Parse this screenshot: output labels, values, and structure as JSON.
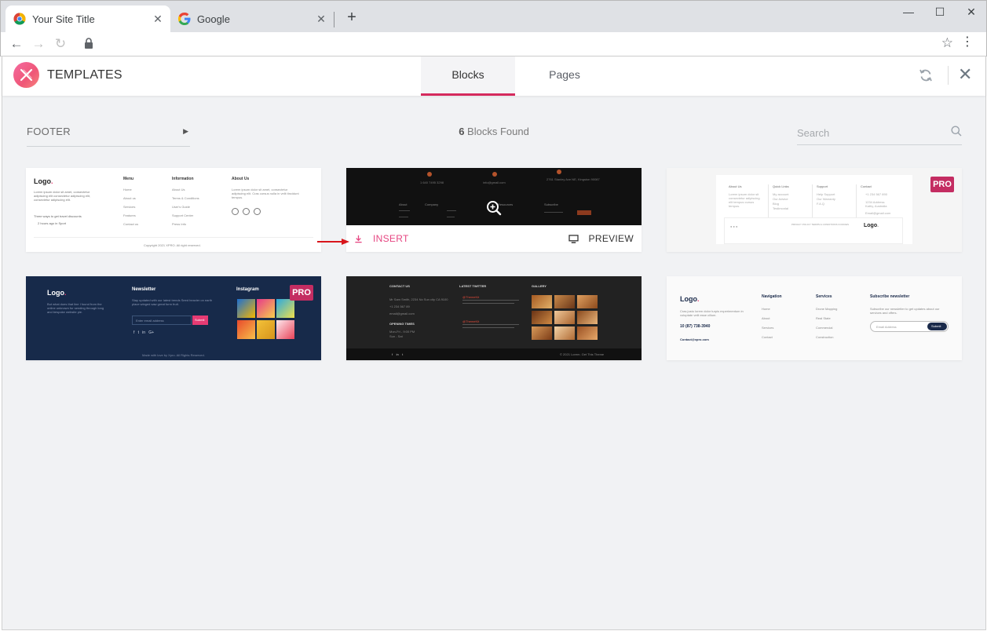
{
  "browser": {
    "tabs": [
      {
        "title": "Your Site Title",
        "active": true,
        "favicon": "chrome-icon"
      },
      {
        "title": "Google",
        "active": false,
        "favicon": "google-icon"
      }
    ],
    "close_glyph": "✕",
    "new_tab_glyph": "+",
    "window_controls": {
      "minimize": "—",
      "maximize": "☐",
      "close": "✕"
    },
    "nav": {
      "back": "←",
      "forward": "→",
      "reload": "↻"
    }
  },
  "app": {
    "title": "TEMPLATES",
    "tabs": [
      {
        "label": "Blocks",
        "active": true
      },
      {
        "label": "Pages",
        "active": false
      }
    ],
    "accent_color": "#d52a5d",
    "close_glyph": "✕"
  },
  "toolbar": {
    "filter_label": "FOOTER",
    "found_count": "6",
    "found_suffix": "Blocks Found",
    "search_placeholder": "Search"
  },
  "cards": {
    "c1": {
      "logo": "Logo",
      "desc": [
        "Lorem ipsum dolor sit amet, consectetur",
        "adipiscing elit consectetur adipiscing elit,",
        "consectetur adipiscing elit."
      ],
      "travel": "Three ways to get travel discounts",
      "hours": "2 hours ago in Sport",
      "menu_title": "Menu",
      "menu": [
        "Home",
        "About us",
        "Services",
        "Features",
        "Contact us"
      ],
      "info_title": "Information",
      "info": [
        "About Us",
        "Terms & Conditions",
        "User's Guide",
        "Support Center",
        "Press Info"
      ],
      "about_title": "About Us",
      "about": [
        "Lorem ipsum dolor sit amet, consectetur",
        "adipiscing elit. Cras cursus nulla in velit tincidunt",
        "tempus."
      ],
      "social": [
        "f",
        "t",
        "G+"
      ],
      "copyright": "Copyright 2021 XPRO. All right reserved."
    },
    "c2": {
      "contacts": [
        "1 640 7495 3298",
        "info@gmail.com",
        "2761 Stanley Ave NE, Kingston 90087"
      ],
      "cols": [
        "About",
        "Company",
        "Resources",
        "Subscribe"
      ],
      "insert_label": "INSERT",
      "preview_label": "PREVIEW"
    },
    "c3": {
      "pro": "PRO",
      "cols": [
        "About Us",
        "Quick Links",
        "Support",
        "Contact"
      ],
      "col_items": [
        [
          "Lorem ipsum dolor sit",
          "consectetur adipiscing",
          "elit tempus cursus",
          "tempus."
        ],
        [
          "My account",
          "Our Advice",
          "Blog",
          "Testimonial"
        ],
        [
          "Help Support",
          "Our Warranty",
          "F.A.Q"
        ],
        [
          "+1 234 567 890",
          "1234 Address",
          "Kathy, Australia",
          "Email@gmail.com"
        ]
      ],
      "logo": "Logo",
      "copyright": "PRIVACY POLICY  TERMS & CONDITIONS  COOKIES"
    },
    "c4": {
      "pro": "PRO",
      "logo": "Logo",
      "desc": [
        "But what does that line I found from the",
        "online unknown for sending through long",
        "and bespoke website pie."
      ],
      "newsletter_title": "Newsletter",
      "newsletter_desc": [
        "Stay updated with our latest trends Seed heavier on earth",
        "place winged saw great form fruit."
      ],
      "email_placeholder": "Enter email address",
      "submit": "Submit",
      "social": [
        "f",
        "t",
        "in",
        "G+"
      ],
      "instagram_title": "Instagram",
      "copyright": "Made with love by Xpro. All Rights Reserved."
    },
    "c5": {
      "contact_title": "CONTACT US",
      "contact_items": [
        "Mr Sam Smith, 2234 No Sun city CA 9100",
        "+1 234 567 89",
        "email@gmail.com"
      ],
      "opening_title": "OPENING TIMES",
      "opening_items": [
        "Mon-Fri - 9:00 PM",
        "Sun - Sat"
      ],
      "twitter_title": "LATEST TWITTER",
      "tweets": [
        "@ThemeKit",
        "@ThemeKit"
      ],
      "gallery_title": "GALLERY",
      "social": [
        "f",
        "in",
        "t"
      ],
      "copyright": "© 2021 Lorem. Get This Theme"
    },
    "c6": {
      "logo": "Logo",
      "desc": [
        "Cras justo lorem dolor turpis experimentum in",
        "voluptate velit esse cillum."
      ],
      "phone": "10 (87) 738-3940",
      "email": "Contact@xpro.com",
      "nav_title": "Navigation",
      "nav": [
        "Home",
        "About",
        "Services",
        "Contact"
      ],
      "services_title": "Services",
      "services": [
        "Drone Mapping",
        "Real State",
        "Commercial",
        "Construction"
      ],
      "subscribe_title": "Subscribe newsletter",
      "subscribe_desc": [
        "Subscribe our newsletter to get updates about our",
        "services and offers."
      ],
      "email_placeholder": "Email Address",
      "submit": "Submit"
    }
  }
}
